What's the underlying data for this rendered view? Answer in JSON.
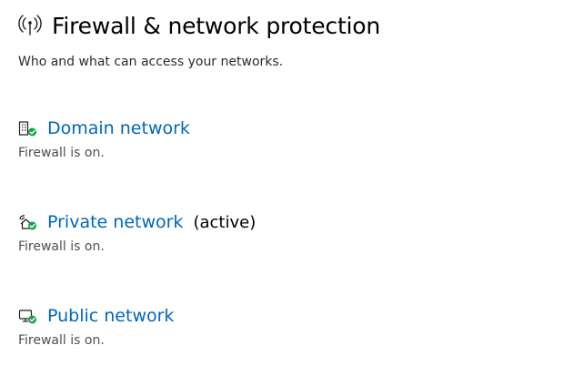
{
  "header": {
    "icon": "antenna-signal-icon",
    "title": "Firewall & network protection",
    "subtitle": "Who and what can access your networks."
  },
  "networks": [
    {
      "icon": "domain-building-check-icon",
      "label": "Domain network",
      "active": "",
      "status": "Firewall is on."
    },
    {
      "icon": "private-house-check-icon",
      "label": "Private network",
      "active": "(active)",
      "status": "Firewall is on."
    },
    {
      "icon": "public-monitor-check-icon",
      "label": "Public network",
      "active": "",
      "status": "Firewall is on."
    }
  ],
  "colors": {
    "link": "#0067b8",
    "check": "#16a34a",
    "icon_stroke": "#1f1f1f"
  }
}
